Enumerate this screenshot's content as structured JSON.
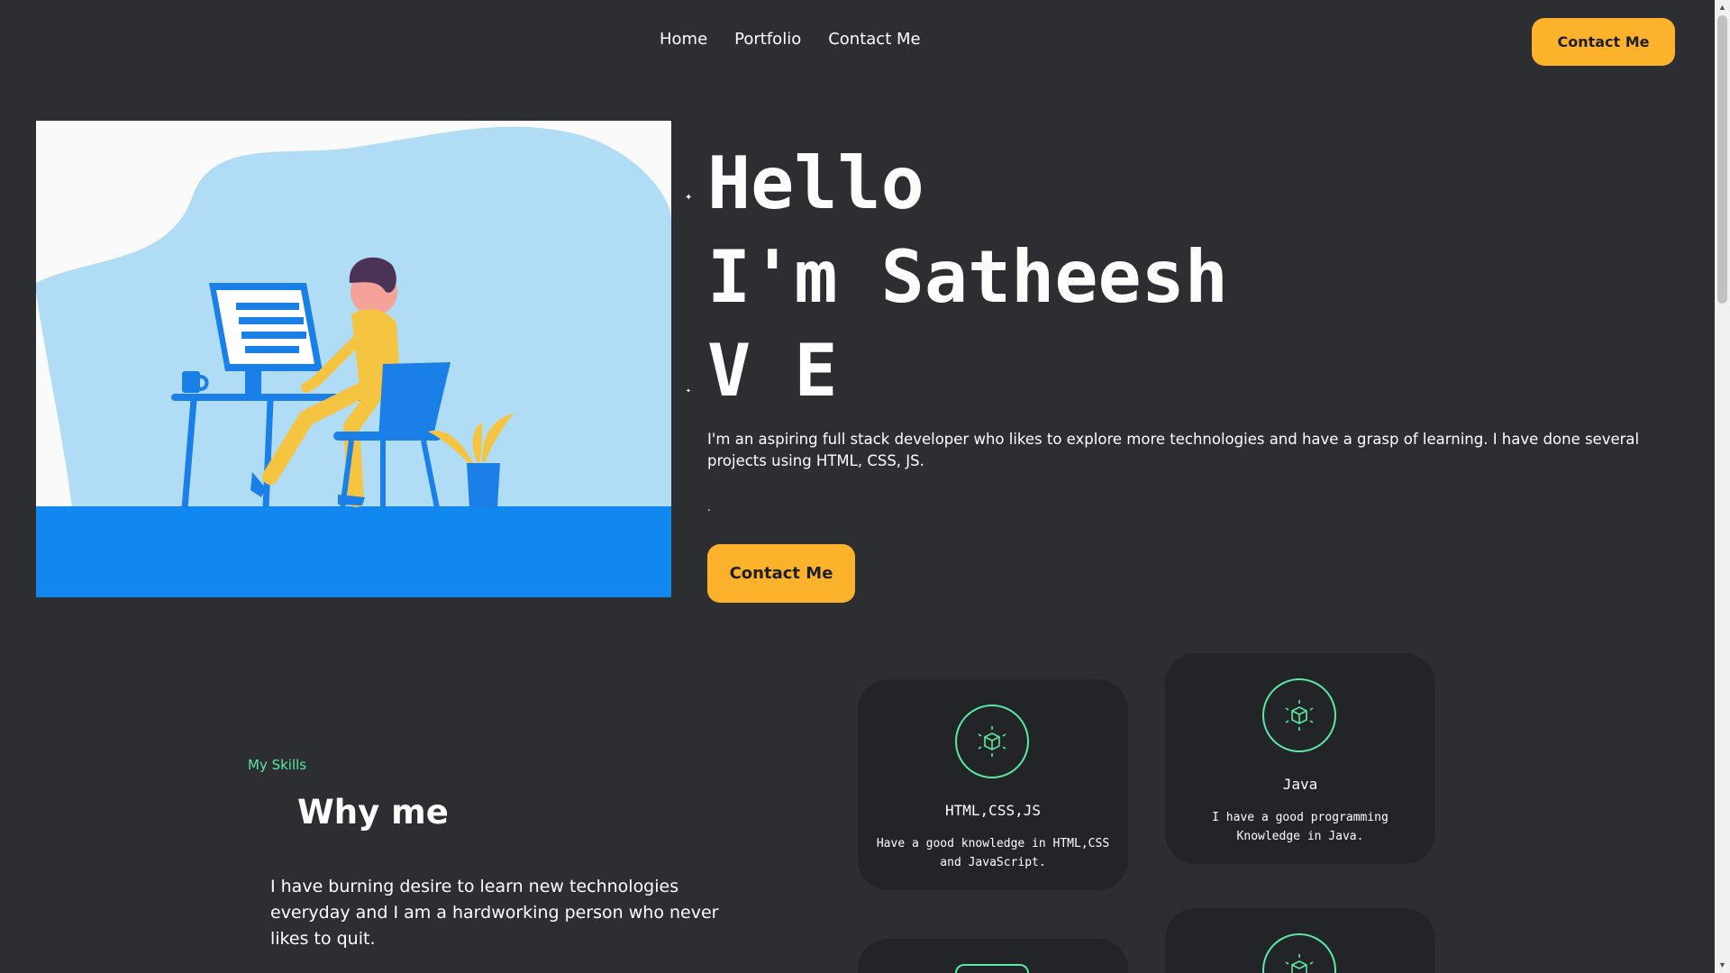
{
  "nav": {
    "links": [
      "Home",
      "Portfolio",
      "Contact Me"
    ],
    "cta_label": "Contact Me"
  },
  "hero": {
    "title_lines": [
      "Hello",
      "I'm Satheesh",
      "V E"
    ],
    "description": "I'm an aspiring full stack developer who likes to explore more technologies and have a grasp of learning. I have done several projects using HTML, CSS, JS.",
    "dot": ".",
    "cta_label": "Contact Me",
    "illustration": "developer-at-desk-illustration"
  },
  "skills": {
    "label": "My Skills",
    "heading": "Why me",
    "text": "I have burning desire to learn new technologies everyday and I am a hardworking person who never likes to quit.",
    "cards": [
      {
        "title": "HTML,CSS,JS",
        "text": "Have a good knowledge in HTML,CSS and JavaScript.",
        "icon": "cube-icon"
      },
      {
        "title": "Java",
        "text": "I have a good programming Knowledge in Java.",
        "icon": "cube-icon"
      },
      {
        "title": "",
        "text": "",
        "icon": "cube-icon"
      },
      {
        "title": "",
        "text": "",
        "icon": "cube-icon"
      }
    ]
  },
  "colors": {
    "background": "#2d2e32",
    "accent": "#fdb22c",
    "green": "#5be9a4",
    "card": "#232427"
  }
}
